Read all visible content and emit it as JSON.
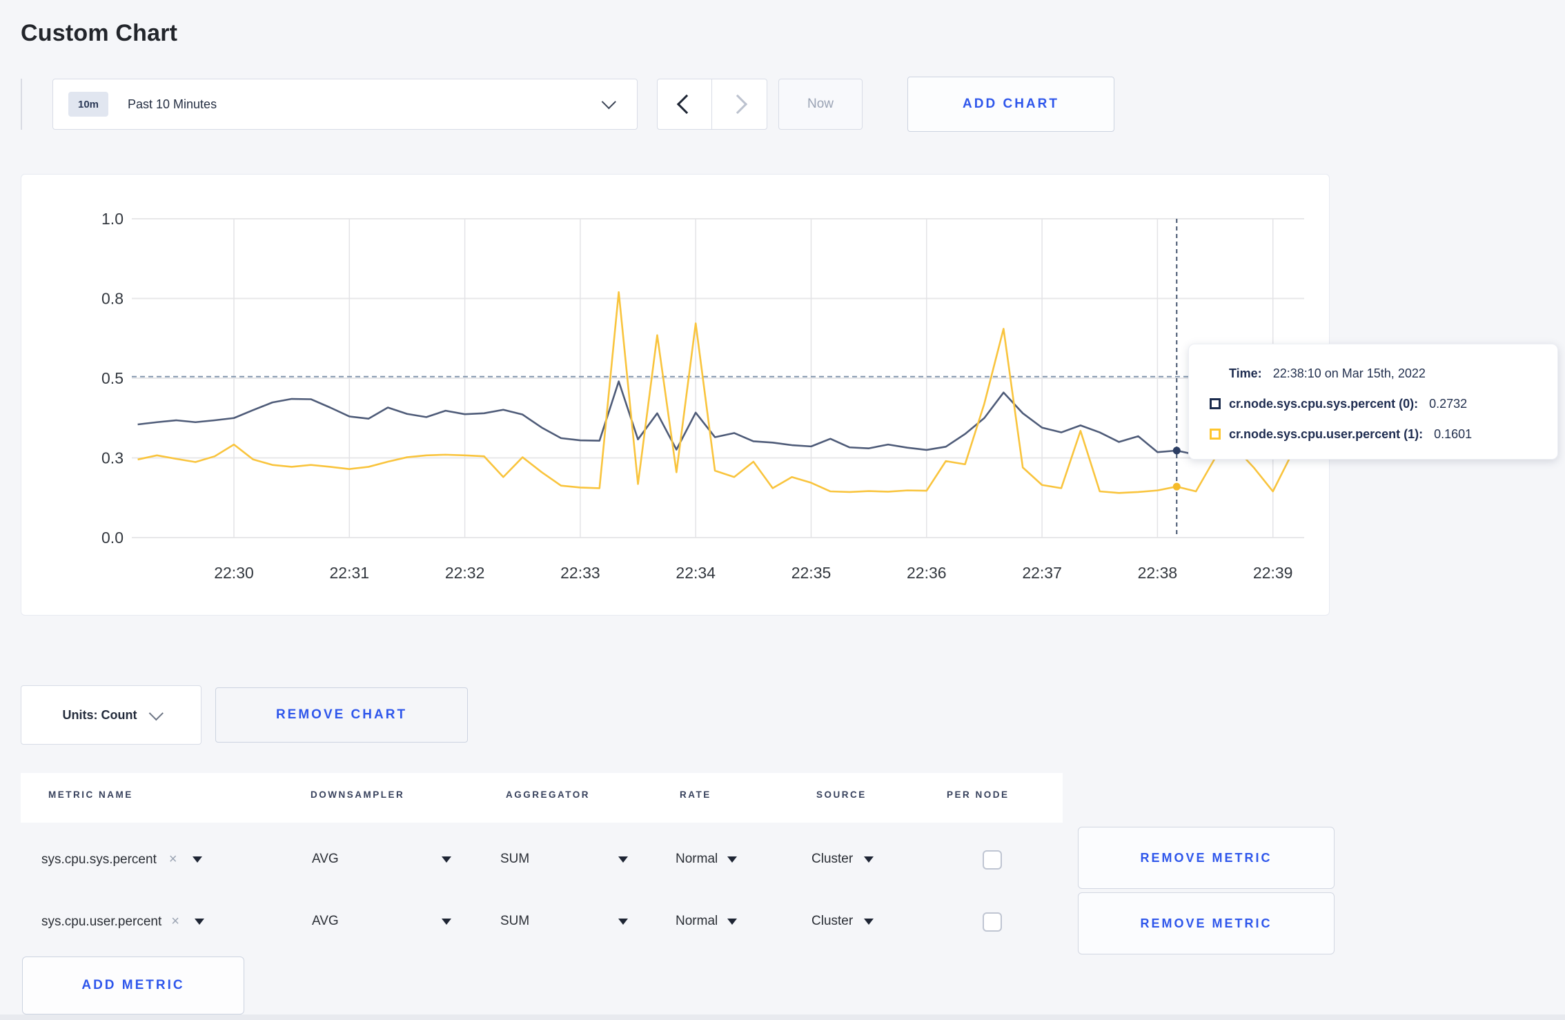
{
  "page": {
    "title": "Custom Chart"
  },
  "toolbar": {
    "range_badge": "10m",
    "range_label": "Past 10 Minutes",
    "now_label": "Now",
    "add_chart_label": "ADD CHART"
  },
  "chart_controls": {
    "units_label": "Units: Count",
    "remove_chart_label": "REMOVE CHART"
  },
  "chart_data": {
    "type": "line",
    "title": "",
    "xlabel": "",
    "ylabel": "",
    "x_start_time": "22:29:10",
    "x_step_seconds": 10,
    "x_ticks": [
      "22:30",
      "22:31",
      "22:32",
      "22:33",
      "22:34",
      "22:35",
      "22:36",
      "22:37",
      "22:38",
      "22:39"
    ],
    "y_tick_labels": [
      "0.0",
      "0.3",
      "0.5",
      "0.8",
      "1.0"
    ],
    "y_tick_values": [
      0,
      0.25,
      0.5,
      0.75,
      1.0
    ],
    "ylim": [
      0,
      1
    ],
    "grid": true,
    "threshold_value": 0.505,
    "series": [
      {
        "name": "cr.node.sys.cpu.sys.percent (0)",
        "color": "#4e5b78",
        "dot_color": "#2c3e63",
        "values": [
          0.355,
          0.362,
          0.368,
          0.362,
          0.368,
          0.375,
          0.4,
          0.424,
          0.435,
          0.434,
          0.408,
          0.38,
          0.373,
          0.408,
          0.388,
          0.378,
          0.398,
          0.387,
          0.39,
          0.401,
          0.386,
          0.345,
          0.312,
          0.305,
          0.304,
          0.49,
          0.308,
          0.39,
          0.276,
          0.392,
          0.315,
          0.328,
          0.302,
          0.298,
          0.29,
          0.286,
          0.31,
          0.283,
          0.28,
          0.292,
          0.282,
          0.275,
          0.285,
          0.325,
          0.375,
          0.455,
          0.39,
          0.345,
          0.33,
          0.352,
          0.33,
          0.3,
          0.318,
          0.268,
          0.273,
          0.26,
          0.255,
          0.262,
          0.272,
          0.285,
          0.295
        ]
      },
      {
        "name": "cr.node.sys.cpu.user.percent (1)",
        "color": "#f9c43d",
        "dot_color": "#f5bb2a",
        "values": [
          0.245,
          0.258,
          0.247,
          0.237,
          0.255,
          0.292,
          0.245,
          0.228,
          0.222,
          0.228,
          0.222,
          0.215,
          0.222,
          0.238,
          0.252,
          0.258,
          0.26,
          0.258,
          0.255,
          0.19,
          0.252,
          0.205,
          0.163,
          0.157,
          0.155,
          0.77,
          0.168,
          0.635,
          0.205,
          0.672,
          0.21,
          0.19,
          0.238,
          0.155,
          0.19,
          0.172,
          0.145,
          0.143,
          0.146,
          0.144,
          0.148,
          0.147,
          0.24,
          0.23,
          0.42,
          0.655,
          0.22,
          0.165,
          0.155,
          0.335,
          0.145,
          0.14,
          0.143,
          0.148,
          0.16,
          0.145,
          0.25,
          0.285,
          0.22,
          0.145,
          0.265
        ]
      }
    ],
    "crosshair": {
      "index": 54,
      "time": "22:38:10",
      "values": [
        0.2732,
        0.1601
      ]
    },
    "legend_position": "tooltip"
  },
  "tooltip": {
    "time_label": "Time:",
    "time_value": "22:38:10 on Mar 15th, 2022",
    "series": [
      {
        "label": "cr.node.sys.cpu.sys.percent (0):",
        "value": "0.2732",
        "color": "#1b2b4d"
      },
      {
        "label": "cr.node.sys.cpu.user.percent (1):",
        "value": "0.1601",
        "color": "#fec62e"
      }
    ]
  },
  "metrics_table": {
    "headers": [
      "METRIC NAME",
      "DOWNSAMPLER",
      "AGGREGATOR",
      "RATE",
      "SOURCE",
      "PER NODE"
    ],
    "remove_icon": "×",
    "remove_metric_label": "REMOVE METRIC",
    "add_metric_label": "ADD METRIC",
    "rows": [
      {
        "metric": "sys.cpu.sys.percent",
        "downsampler": "AVG",
        "aggregator": "SUM",
        "rate": "Normal",
        "source": "Cluster",
        "per_node_checked": false
      },
      {
        "metric": "sys.cpu.user.percent",
        "downsampler": "AVG",
        "aggregator": "SUM",
        "rate": "Normal",
        "source": "Cluster",
        "per_node_checked": false
      }
    ]
  }
}
